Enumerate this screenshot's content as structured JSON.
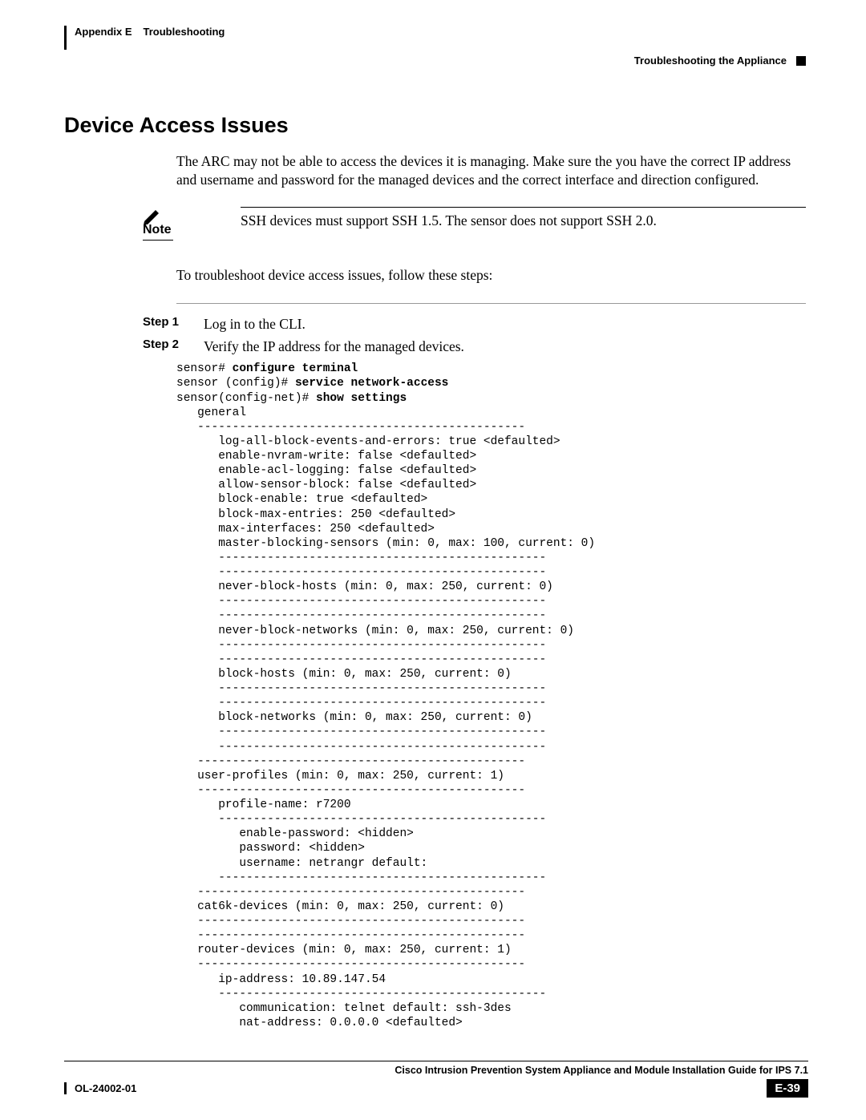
{
  "header": {
    "appendix": "Appendix E",
    "chapter": "Troubleshooting",
    "section_path": "Troubleshooting the Appliance"
  },
  "section_title": "Device Access Issues",
  "intro": "The ARC may not be able to access the devices it is managing. Make sure the you have the correct IP address and username and password for the managed devices and the correct interface and direction configured.",
  "note": {
    "label": "Note",
    "text": "SSH devices must support SSH 1.5. The sensor does not support SSH 2.0."
  },
  "followup": "To troubleshoot device access issues, follow these steps:",
  "steps": {
    "s1": {
      "label": "Step 1",
      "text": "Log in to the CLI."
    },
    "s2": {
      "label": "Step 2",
      "text": "Verify the IP address for the managed devices."
    }
  },
  "cli": {
    "l01a": "sensor# ",
    "l01b": "configure terminal",
    "l02a": "sensor (config)# ",
    "l02b": "service network-access",
    "l03a": "sensor(config-net)# ",
    "l03b": "show settings",
    "l04": "   general",
    "l05": "   -----------------------------------------------",
    "l06": "      log-all-block-events-and-errors: true <defaulted>",
    "l07": "      enable-nvram-write: false <defaulted>",
    "l08": "      enable-acl-logging: false <defaulted>",
    "l09": "      allow-sensor-block: false <defaulted>",
    "l10": "      block-enable: true <defaulted>",
    "l11": "      block-max-entries: 250 <defaulted>",
    "l12": "      max-interfaces: 250 <defaulted>",
    "l13": "      master-blocking-sensors (min: 0, max: 100, current: 0)",
    "l14": "      -----------------------------------------------",
    "l15": "      -----------------------------------------------",
    "l16": "      never-block-hosts (min: 0, max: 250, current: 0)",
    "l17": "      -----------------------------------------------",
    "l18": "      -----------------------------------------------",
    "l19": "      never-block-networks (min: 0, max: 250, current: 0)",
    "l20": "      -----------------------------------------------",
    "l21": "      -----------------------------------------------",
    "l22": "      block-hosts (min: 0, max: 250, current: 0)",
    "l23": "      -----------------------------------------------",
    "l24": "      -----------------------------------------------",
    "l25": "      block-networks (min: 0, max: 250, current: 0)",
    "l26": "      -----------------------------------------------",
    "l27": "      -----------------------------------------------",
    "l28": "   -----------------------------------------------",
    "l29": "   user-profiles (min: 0, max: 250, current: 1)",
    "l30": "   -----------------------------------------------",
    "l31": "      profile-name: r7200",
    "l32": "      -----------------------------------------------",
    "l33": "         enable-password: <hidden>",
    "l34": "         password: <hidden>",
    "l35": "         username: netrangr default:",
    "l36": "      -----------------------------------------------",
    "l37": "   -----------------------------------------------",
    "l38": "   cat6k-devices (min: 0, max: 250, current: 0)",
    "l39": "   -----------------------------------------------",
    "l40": "   -----------------------------------------------",
    "l41": "   router-devices (min: 0, max: 250, current: 1)",
    "l42": "   -----------------------------------------------",
    "l43": "      ip-address: 10.89.147.54",
    "l44": "      -----------------------------------------------",
    "l45": "         communication: telnet default: ssh-3des",
    "l46": "         nat-address: 0.0.0.0 <defaulted>"
  },
  "footer": {
    "guide": "Cisco Intrusion Prevention System Appliance and Module Installation Guide for IPS 7.1",
    "doc_id": "OL-24002-01",
    "page": "E-39"
  }
}
